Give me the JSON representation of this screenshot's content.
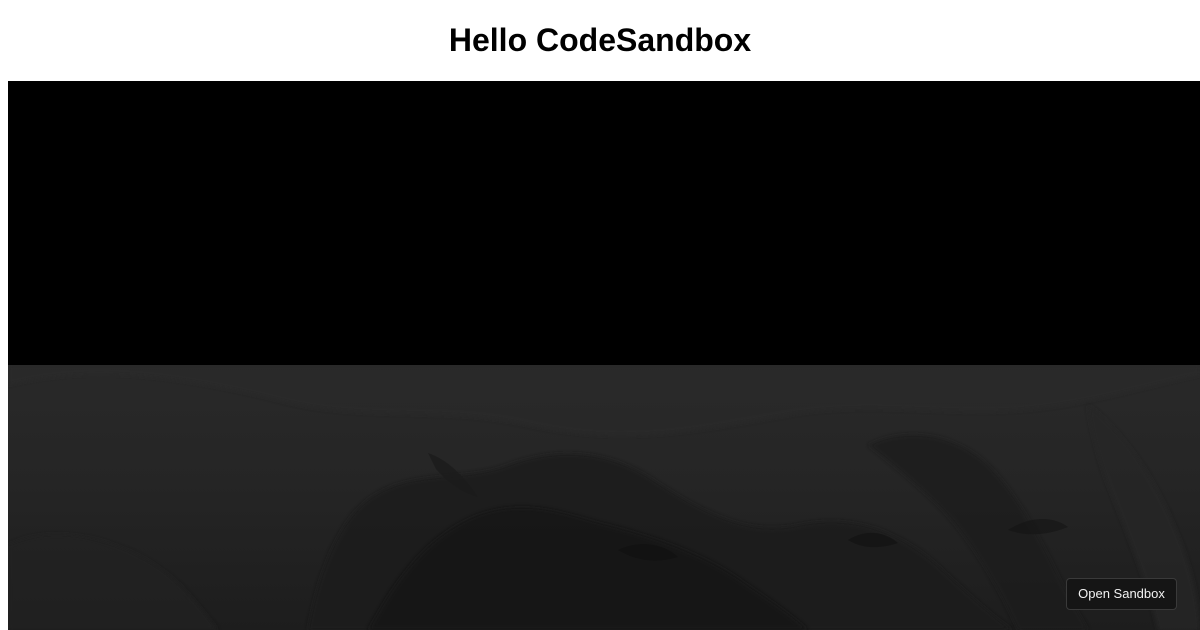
{
  "page": {
    "title": "Hello CodeSandbox"
  },
  "embed": {
    "open_button_label": "Open Sandbox"
  },
  "colors": {
    "page_background": "#ffffff",
    "preview_top": "#000000",
    "preview_bottom": "#242424",
    "button_background": "#151515",
    "button_text": "#f2f2f2"
  }
}
